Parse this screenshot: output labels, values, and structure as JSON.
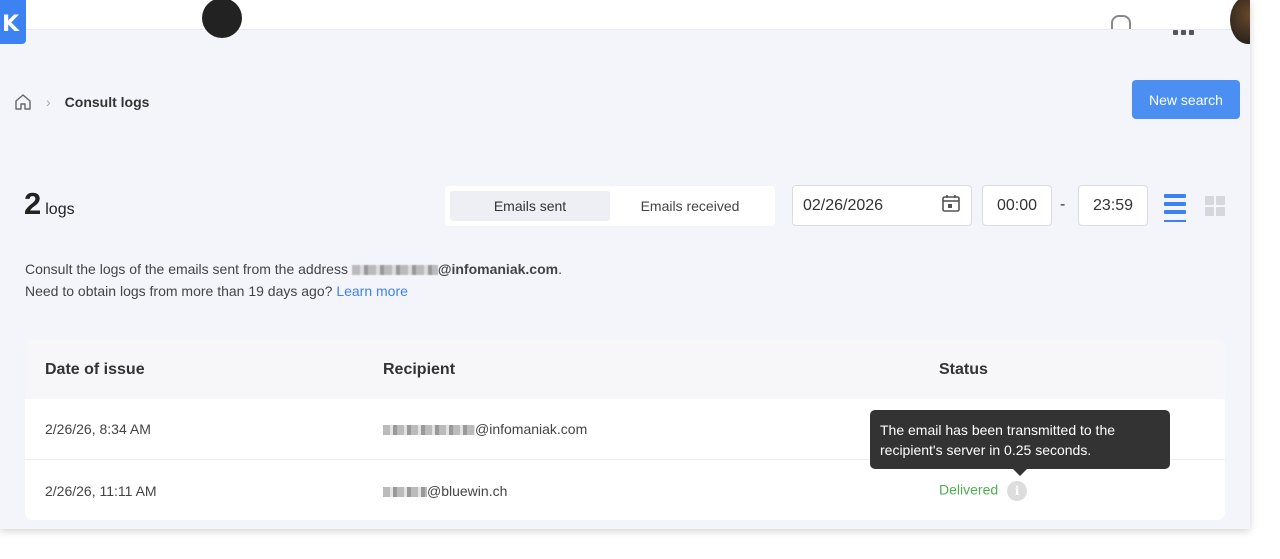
{
  "header": {
    "logo_letter": "K"
  },
  "breadcrumb": {
    "current": "Consult logs"
  },
  "actions": {
    "new_search_label": "New search"
  },
  "summary": {
    "count": "2",
    "count_label": "logs"
  },
  "toggle": {
    "sent_label": "Emails sent",
    "received_label": "Emails received",
    "active": "Emails sent"
  },
  "filters": {
    "date": "02/26/2026",
    "time_from": "00:00",
    "time_sep": "-",
    "time_to": "23:59"
  },
  "intro": {
    "line1_prefix": "Consult the logs of the emails sent from the address",
    "line1_domain": "@infomaniak.com",
    "line1_suffix": ".",
    "line2_prefix": "Need to obtain logs from more than 19 days ago?",
    "learn_more": "Learn more"
  },
  "table": {
    "columns": [
      "Date of issue",
      "Recipient",
      "Status"
    ],
    "rows": [
      {
        "date": "2/26/26, 8:34 AM",
        "recipient_domain": "@infomaniak.com",
        "status": ""
      },
      {
        "date": "2/26/26, 11:11 AM",
        "recipient_domain": "@bluewin.ch",
        "status": "Delivered"
      }
    ]
  },
  "tooltip": {
    "text": "The email has been transmitted to the recipient's server in 0.25 seconds."
  },
  "colors": {
    "accent": "#4b8ff3",
    "delivered": "#4caf50",
    "tooltip_bg": "#333333"
  }
}
